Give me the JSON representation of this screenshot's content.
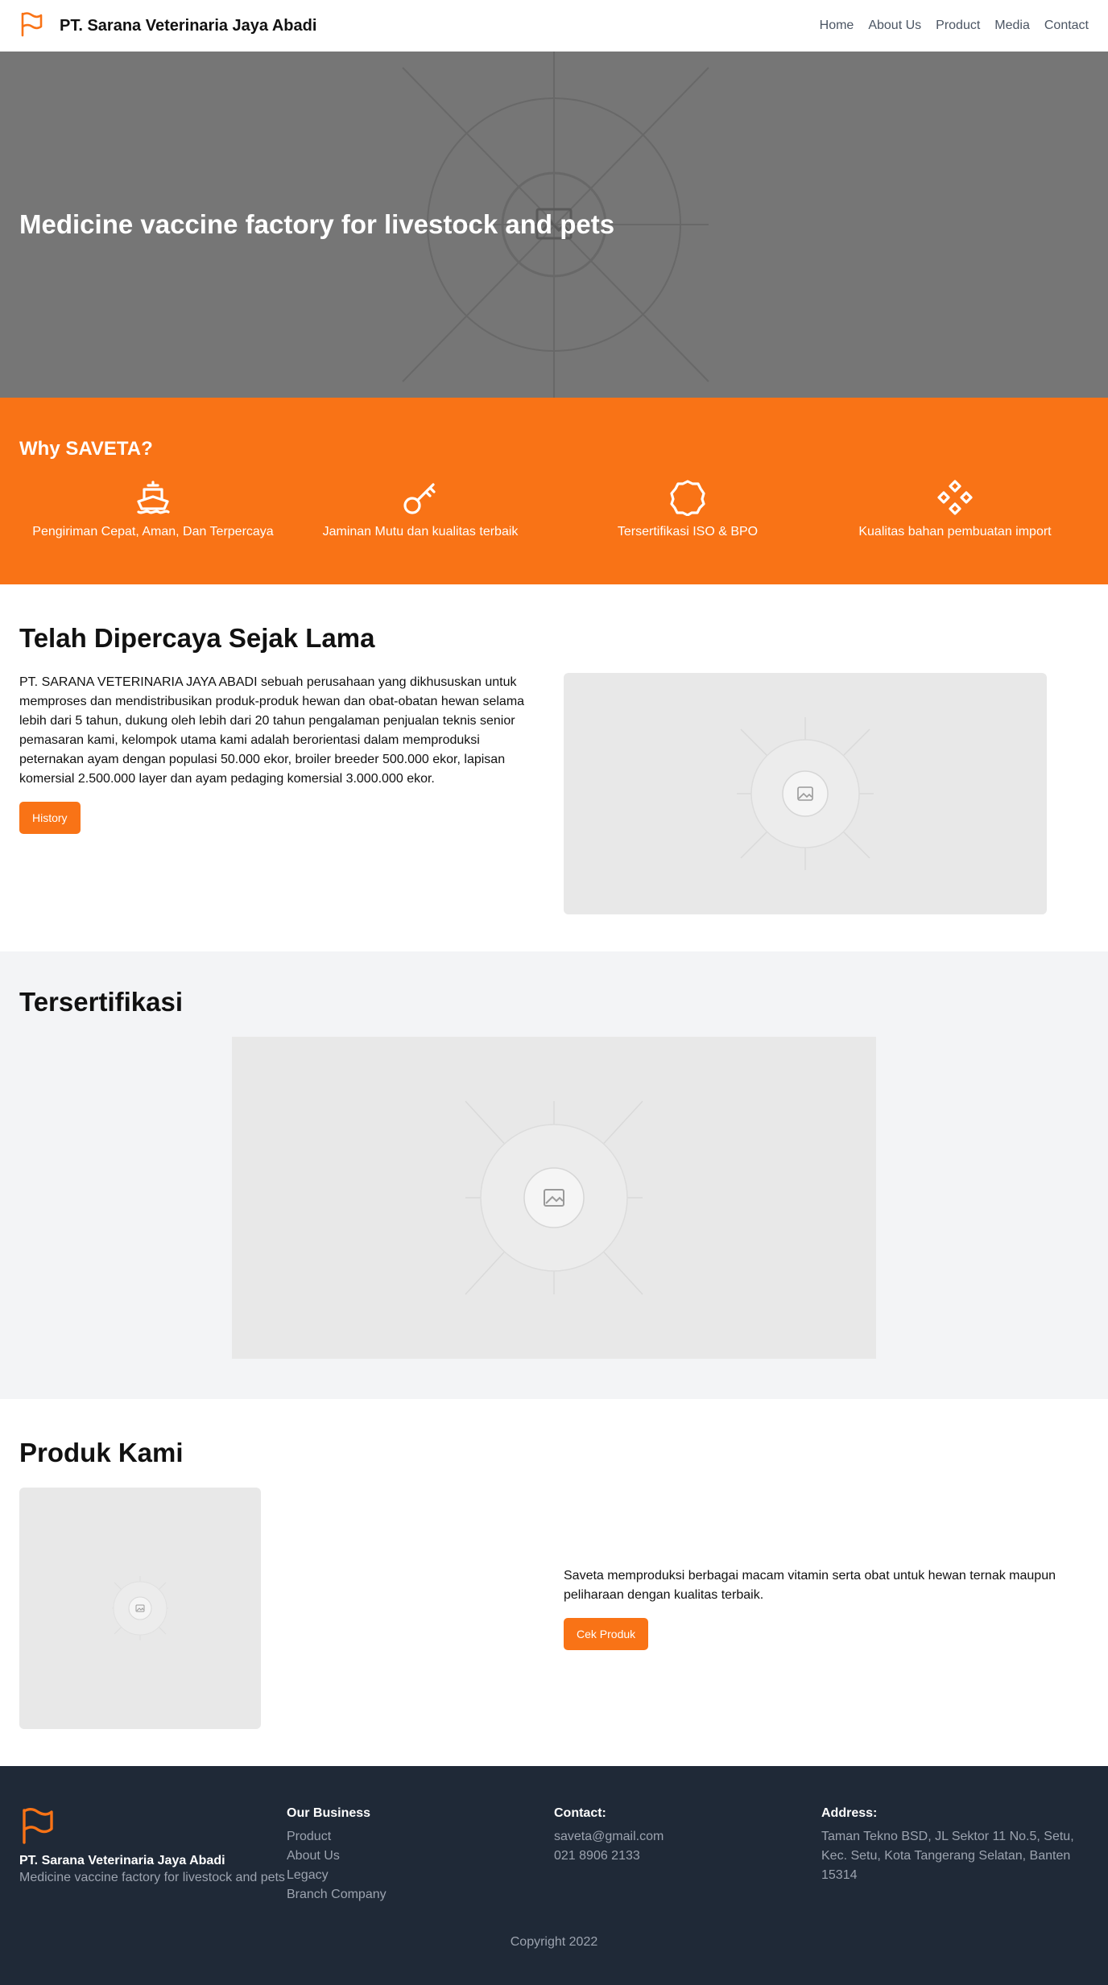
{
  "brand": {
    "name": "PT. Sarana Veterinaria Jaya Abadi",
    "accent_color": "#f97316",
    "logo_icon": "flag-icon"
  },
  "nav": {
    "items": [
      {
        "label": "Home"
      },
      {
        "label": "About Us"
      },
      {
        "label": "Product"
      },
      {
        "label": "Media"
      },
      {
        "label": "Contact"
      }
    ]
  },
  "hero": {
    "title": "Medicine vaccine factory for livestock and pets",
    "background_color": "#767676"
  },
  "why": {
    "title": "Why SAVETA?",
    "background_color": "#f97316",
    "items": [
      {
        "icon": "ship-icon",
        "label": "Pengiriman Cepat, Aman, Dan Terpercaya"
      },
      {
        "icon": "key-icon",
        "label": "Jaminan Mutu dan kualitas terbaik"
      },
      {
        "icon": "badge-icon",
        "label": "Tersertifikasi ISO & BPO"
      },
      {
        "icon": "diamonds-icon",
        "label": "Kualitas bahan pembuatan import"
      }
    ]
  },
  "trusted": {
    "title": "Telah Dipercaya Sejak Lama",
    "body": "PT. SARANA VETERINARIA JAYA ABADI sebuah perusahaan yang dikhususkan untuk memproses dan mendistribusikan produk-produk hewan dan obat-obatan hewan selama lebih dari 5 tahun, dukung oleh lebih dari 20 tahun pengalaman penjualan teknis senior pemasaran kami, kelompok utama kami adalah berorientasi dalam memproduksi peternakan ayam dengan populasi 50.000 ekor, broiler breeder 500.000 ekor, lapisan komersial 2.500.000 layer dan ayam pedaging komersial 3.000.000 ekor.",
    "button_label": "History"
  },
  "certified": {
    "title": "Tersertifikasi"
  },
  "products": {
    "title": "Produk Kami",
    "body": "Saveta memproduksi berbagai macam vitamin serta obat untuk hewan ternak maupun peliharaan dengan kualitas terbaik.",
    "button_label": "Cek Produk"
  },
  "footer": {
    "company_name": "PT. Sarana Veterinaria Jaya Abadi",
    "tagline": "Medicine vaccine factory for livestock and pets",
    "business": {
      "title": "Our Business",
      "links": [
        {
          "label": "Product"
        },
        {
          "label": "About Us"
        },
        {
          "label": "Legacy"
        },
        {
          "label": "Branch Company"
        }
      ]
    },
    "contact": {
      "title": "Contact:",
      "email": "saveta@gmail.com",
      "phone": "021 8906 2133"
    },
    "address": {
      "title": "Address:",
      "text": "Taman Tekno BSD, JL Sektor 11 No.5, Setu, Kec. Setu, Kota Tangerang Selatan, Banten 15314"
    },
    "copyright": "Copyright 2022",
    "background_color": "#1f2937"
  }
}
